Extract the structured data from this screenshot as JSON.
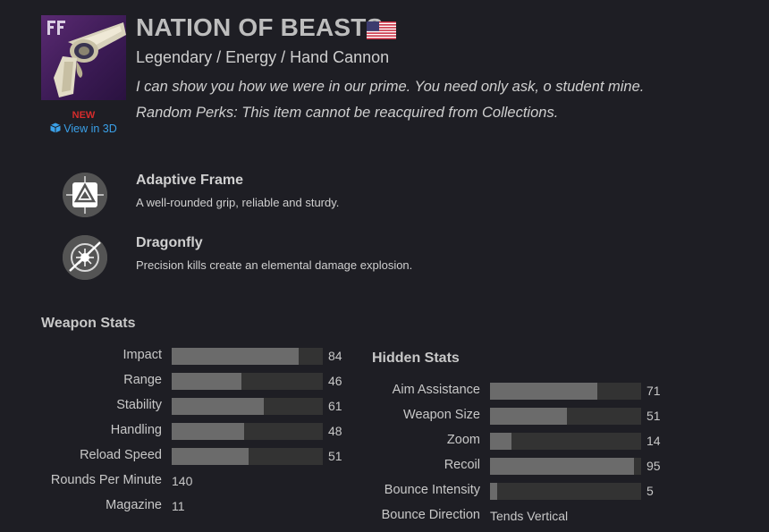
{
  "item": {
    "name": "NATION OF BEASTS",
    "new_label": "NEW",
    "view3d_label": "View in 3D",
    "type_line": "Legendary / Energy / Hand Cannon",
    "flavor": "I can show you how we were in our prime. You need only ask, o student mine.",
    "random_perks_note": "Random Perks: This item cannot be reacquired from Collections.",
    "flag_icon": "us-flag-icon",
    "thumbnail_icon": "hand-cannon-icon"
  },
  "perks": [
    {
      "name": "Adaptive Frame",
      "description": "A well-rounded grip, reliable and sturdy.",
      "icon": "adaptive-frame-icon"
    },
    {
      "name": "Dragonfly",
      "description": "Precision kills create an elemental damage explosion.",
      "icon": "dragonfly-icon"
    }
  ],
  "weapon_stats": {
    "title": "Weapon Stats",
    "bars": [
      {
        "label": "Impact",
        "value": "84",
        "level": 84
      },
      {
        "label": "Range",
        "value": "46",
        "level": 46
      },
      {
        "label": "Stability",
        "value": "61",
        "level": 61
      },
      {
        "label": "Handling",
        "value": "48",
        "level": 48
      },
      {
        "label": "Reload Speed",
        "value": "51",
        "level": 51
      }
    ],
    "plain": [
      {
        "label": "Rounds Per Minute",
        "value": "140"
      },
      {
        "label": "Magazine",
        "value": "11"
      }
    ]
  },
  "hidden_stats": {
    "title": "Hidden Stats",
    "bars": [
      {
        "label": "Aim Assistance",
        "value": "71",
        "level": 71
      },
      {
        "label": "Weapon Size",
        "value": "51",
        "level": 51
      },
      {
        "label": "Zoom",
        "value": "14",
        "level": 14
      },
      {
        "label": "Recoil",
        "value": "95",
        "level": 95
      },
      {
        "label": "Bounce Intensity",
        "value": "5",
        "level": 5
      }
    ],
    "plain": [
      {
        "label": "Bounce Direction",
        "value": "Tends Vertical"
      }
    ]
  },
  "colors": {
    "new_badge": "#d62c2c",
    "link": "#3aa0e8",
    "bar_fill": "#6b6b6b",
    "bar_track": "#333333"
  }
}
